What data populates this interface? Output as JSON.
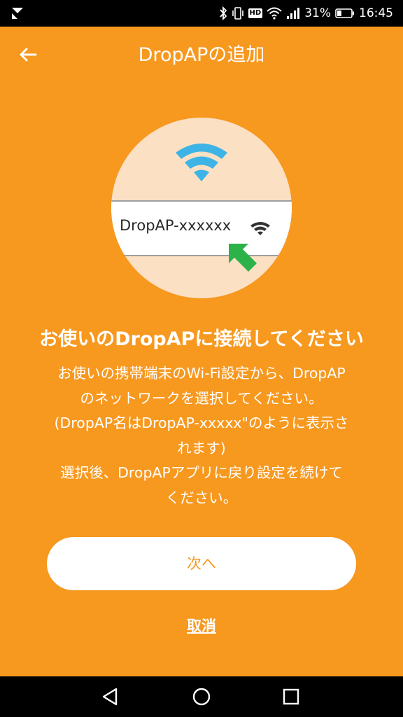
{
  "status_bar": {
    "battery_percent": "31%",
    "time": "16:45",
    "hd_badge": "HD",
    "battery_level": 0.31,
    "icons": [
      "app-notification-icon",
      "bluetooth-icon",
      "vibrate-icon",
      "hd-badge",
      "wifi-icon",
      "cell-signal-icon",
      "battery-icon"
    ]
  },
  "app_bar": {
    "title": "DropAPの追加",
    "back_icon": "arrow-left-icon"
  },
  "illustration": {
    "ssid": "DropAP-xxxxxx",
    "icons": [
      "wifi-icon",
      "wifi-signal-icon",
      "pointer-arrow-icon"
    ],
    "colors": {
      "circle": "#FCE0C4",
      "wifi": "#3DB4E5",
      "arrow": "#2DB24A"
    }
  },
  "main": {
    "heading": "お使いのDropAPに接続してください",
    "instructions": [
      "お使いの携帯端末のWi-Fi設定から、DropAP",
      "のネットワークを選択してください。",
      "(DropAP名はDropAP-xxxxx\"のように表示さ",
      "れます)",
      "選択後、DropAPアプリに戻り設定を続けて",
      "ください。"
    ],
    "next_label": "次へ",
    "cancel_label": "取消"
  },
  "nav_bar": {
    "icons": [
      "back-triangle-icon",
      "home-circle-icon",
      "recents-square-icon"
    ]
  },
  "colors": {
    "background": "#F7981F",
    "button_text": "#F7981F",
    "text": "#FFFFFF"
  }
}
